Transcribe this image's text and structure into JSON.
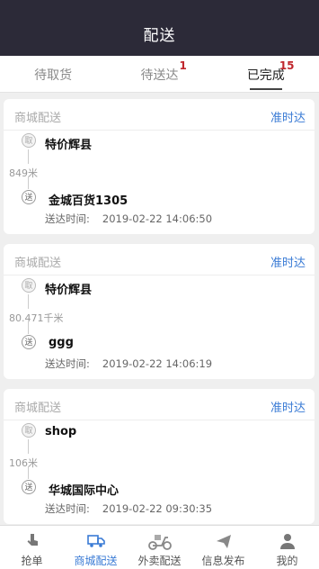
{
  "header": {
    "title": "配送"
  },
  "tabs": [
    {
      "label": "待取货",
      "badge": ""
    },
    {
      "label": "待送达",
      "badge": "1"
    },
    {
      "label": "已完成",
      "badge": "15"
    }
  ],
  "cards": [
    {
      "type": "商城配送",
      "status": "准时达",
      "pick_icon": "取",
      "pick_name": "特价辉县",
      "distance": "849米",
      "drop_icon": "送",
      "drop_name": "金城百货1305",
      "time_label": "送达时间:",
      "time_value": "2019-02-22 14:06:50"
    },
    {
      "type": "商城配送",
      "status": "准时达",
      "pick_icon": "取",
      "pick_name": "特价辉县",
      "distance": "80.471千米",
      "drop_icon": "送",
      "drop_name": "ggg",
      "time_label": "送达时间:",
      "time_value": "2019-02-22 14:06:19"
    },
    {
      "type": "商城配送",
      "status": "准时达",
      "pick_icon": "取",
      "pick_name": "shop",
      "distance": "106米",
      "drop_icon": "送",
      "drop_name": "华城国际中心",
      "time_label": "送达时间:",
      "time_value": "2019-02-22 09:30:35"
    }
  ],
  "nav": [
    {
      "label": "抢单",
      "icon": "hand-pointer-icon"
    },
    {
      "label": "商城配送",
      "icon": "delivery-truck-icon"
    },
    {
      "label": "外卖配送",
      "icon": "scooter-icon"
    },
    {
      "label": "信息发布",
      "icon": "paper-plane-icon"
    },
    {
      "label": "我的",
      "icon": "user-icon"
    }
  ],
  "colors": {
    "header_bg": "#2c2a38",
    "accent": "#3a7bd5",
    "badge": "#c0272d"
  }
}
